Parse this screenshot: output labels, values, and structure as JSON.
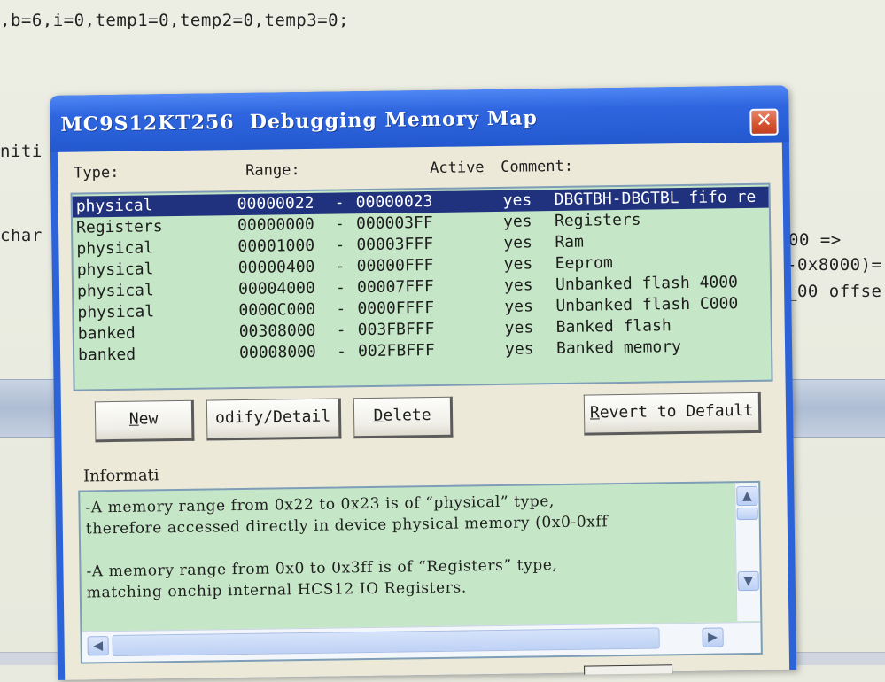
{
  "editor": {
    "line1": ",b=6,i=0,temp1=0,temp2=0,temp3=0;",
    "left_fragment_1": "niti",
    "left_fragment_2": "char",
    "right_fragment_1": "00 =>",
    "right_fragment_2": "-0x8000)=",
    "right_fragment_3": "_00 offse"
  },
  "dialog": {
    "title": "MC9S12KT256  Debugging Memory Map",
    "close_label": "✕",
    "columns": {
      "type": "Type:",
      "range": "Range:",
      "active": "Active",
      "comment": "Comment:"
    },
    "rows": [
      {
        "type": "physical",
        "start": "00000022",
        "end": "00000023",
        "active": "yes",
        "comment": "DBGTBH-DBGTBL fifo re"
      },
      {
        "type": "Registers",
        "start": "00000000",
        "end": "000003FF",
        "active": "yes",
        "comment": "Registers"
      },
      {
        "type": "physical",
        "start": "00001000",
        "end": "00003FFF",
        "active": "yes",
        "comment": "Ram"
      },
      {
        "type": "physical",
        "start": "00000400",
        "end": "00000FFF",
        "active": "yes",
        "comment": "Eeprom"
      },
      {
        "type": "physical",
        "start": "00004000",
        "end": "00007FFF",
        "active": "yes",
        "comment": "Unbanked flash 4000"
      },
      {
        "type": "physical",
        "start": "0000C000",
        "end": "0000FFFF",
        "active": "yes",
        "comment": "Unbanked flash C000"
      },
      {
        "type": "banked",
        "start": "00308000",
        "end": "003FBFFF",
        "active": "yes",
        "comment": "Banked flash"
      },
      {
        "type": "banked",
        "start": "00008000",
        "end": "002FBFFF",
        "active": "yes",
        "comment": "Banked memory"
      }
    ],
    "range_separator": "-",
    "buttons": {
      "new_prefix": "",
      "new_mnemonic": "N",
      "new_rest": "ew",
      "modify": "odify/Detail",
      "delete_mnemonic": "D",
      "delete_rest": "elete",
      "revert_mnemonic": "R",
      "revert_rest": "evert to Default"
    },
    "info_label": "Informati",
    "info_lines": [
      "-A memory range from 0x22 to 0x23 is of “physical” type,",
      "therefore accessed directly in device physical memory (0x0-0xff",
      "-A memory range from 0x0 to 0x3ff is of “Registers” type,",
      "matching onchip internal HCS12 IO Registers."
    ]
  },
  "colors": {
    "titlebar": "#2358cf",
    "selection": "#20327e",
    "list_background": "#c6e7c7",
    "close_button": "#d4522e"
  },
  "icons": [
    "close-icon",
    "scroll-up-icon",
    "scroll-down-icon",
    "scroll-left-icon",
    "scroll-right-icon"
  ]
}
